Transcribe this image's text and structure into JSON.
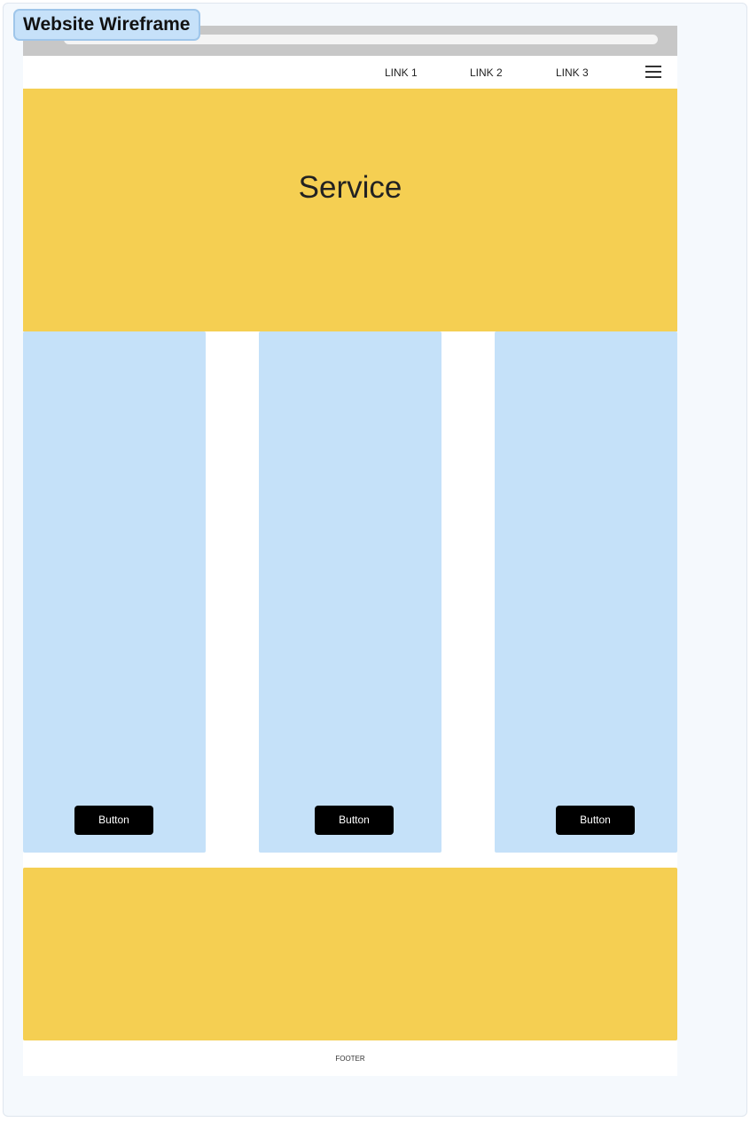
{
  "frame": {
    "label": "Website Wireframe"
  },
  "nav": {
    "links": [
      "LINK 1",
      "LINK 2",
      "LINK 3"
    ],
    "menu_icon": "hamburger-menu-icon"
  },
  "hero": {
    "title": "Service"
  },
  "cards": [
    {
      "button_label": "Button"
    },
    {
      "button_label": "Button"
    },
    {
      "button_label": "Button"
    }
  ],
  "footer": {
    "text": "FOOTER"
  },
  "colors": {
    "canvas": "#f5f9fd",
    "label_bg": "#c6e1f9",
    "browser_bar": "#c7c7c7",
    "accent_yellow": "#f5cf52",
    "card_blue": "#c5e1f9",
    "button": "#000000"
  }
}
